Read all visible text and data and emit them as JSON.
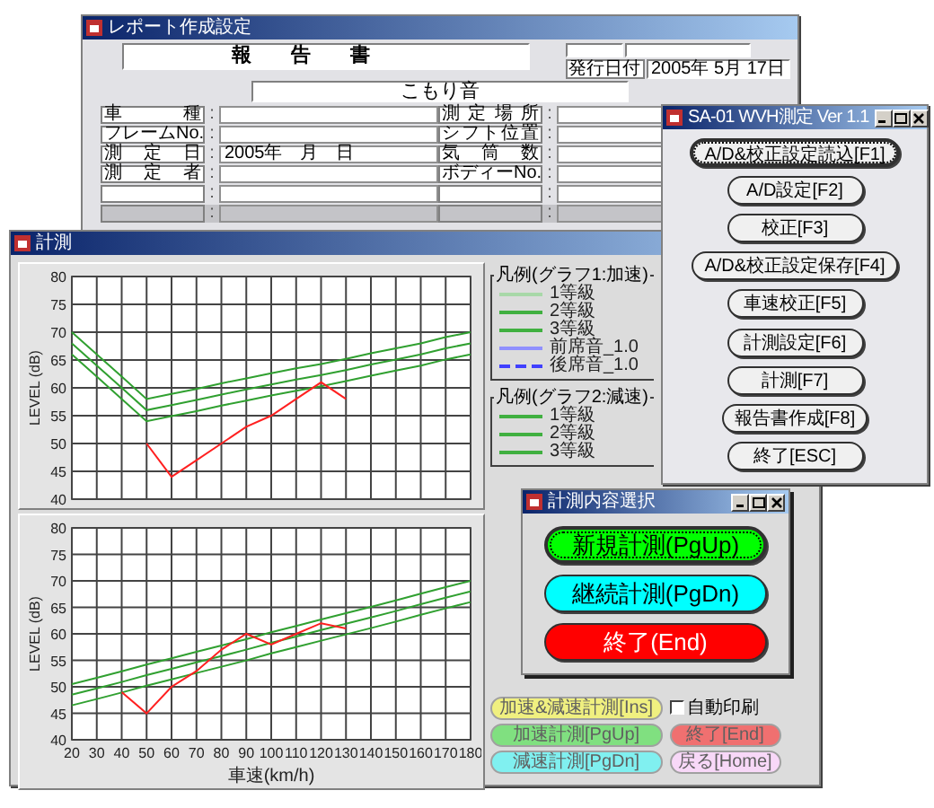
{
  "report_window": {
    "title": "レポート作成設定",
    "heading": "報　　告　　書",
    "issue_date_label": "発行日付",
    "issue_date": "2005年 5月 17日",
    "subtitle": "こもり音",
    "rows": [
      {
        "left_label": "車種",
        "left_sep": ":",
        "right_label": "測定場所",
        "right_sep": ":",
        "disabled": false
      },
      {
        "left_label": "フレームNo.",
        "left_sep": ":",
        "right_label": "シフト位置",
        "right_sep": ":",
        "disabled": false
      },
      {
        "left_label": "測定日",
        "left_sep": ":",
        "left_value": "2005年　月　日",
        "right_label": "気筒数",
        "right_sep": ":",
        "disabled": false
      },
      {
        "left_label": "測定者",
        "left_sep": ":",
        "right_label": "ボディーNo.",
        "right_sep": ":",
        "disabled": false
      },
      {
        "left_sep": ":",
        "right_sep": ":",
        "disabled": false
      },
      {
        "left_sep": ":",
        "right_sep": ":",
        "disabled": true
      }
    ]
  },
  "measure_window": {
    "title": "計測",
    "charts": [
      {
        "chart_data": {
          "type": "line",
          "grid": true,
          "ylabel": "LEVEL (dB)",
          "xlim": [
            20,
            180
          ],
          "ylim": [
            40,
            80
          ],
          "yticks": [
            40,
            45,
            50,
            55,
            60,
            65,
            70,
            75,
            80
          ],
          "x": [
            20,
            30,
            40,
            50,
            60,
            70,
            80,
            90,
            100,
            110,
            120,
            130,
            140,
            150,
            160,
            170,
            180
          ],
          "series": [
            {
              "color": "#30a030",
              "values": [
                70,
                66,
                62,
                58,
                58.9,
                59.8,
                60.8,
                61.7,
                62.6,
                63.5,
                64.3,
                65.2,
                66.2,
                67.1,
                68,
                69.1,
                70
              ]
            },
            {
              "color": "#30a030",
              "values": [
                68,
                64,
                60,
                56,
                56.9,
                57.8,
                58.8,
                59.7,
                60.6,
                61.5,
                62.3,
                63.2,
                64.2,
                65.1,
                66,
                67.1,
                68
              ]
            },
            {
              "color": "#30a030",
              "values": [
                66,
                62,
                58,
                54,
                54.9,
                55.8,
                56.8,
                57.7,
                58.6,
                59.5,
                60.3,
                61.2,
                62.2,
                63.1,
                64,
                65.1,
                66
              ]
            },
            {
              "color": "#ff2020",
              "values": [
                null,
                null,
                null,
                50,
                44,
                47,
                50,
                53,
                55,
                58,
                61,
                58,
                null,
                null,
                null,
                null,
                null
              ]
            }
          ]
        }
      },
      {
        "chart_data": {
          "type": "line",
          "grid": true,
          "xlabel": "車速(km/h)",
          "ylabel": "LEVEL (dB)",
          "xlim": [
            20,
            180
          ],
          "ylim": [
            40,
            80
          ],
          "xticks": [
            20,
            30,
            40,
            50,
            60,
            70,
            80,
            90,
            100,
            110,
            120,
            130,
            140,
            150,
            160,
            170,
            180
          ],
          "yticks": [
            40,
            45,
            50,
            55,
            60,
            65,
            70,
            75,
            80
          ],
          "x": [
            20,
            30,
            40,
            50,
            60,
            70,
            80,
            90,
            100,
            110,
            120,
            130,
            140,
            150,
            160,
            170,
            180
          ],
          "series": [
            {
              "color": "#30a030",
              "values": [
                50.5,
                51.7,
                52.9,
                54.2,
                55.4,
                56.6,
                57.8,
                59,
                60.3,
                61.5,
                62.7,
                63.9,
                65.1,
                66.3,
                67.6,
                68.8,
                70
              ]
            },
            {
              "color": "#30a030",
              "values": [
                48.5,
                49.7,
                50.9,
                52.2,
                53.4,
                54.6,
                55.8,
                57,
                58.3,
                59.5,
                60.7,
                61.9,
                63.1,
                64.3,
                65.6,
                66.8,
                68
              ]
            },
            {
              "color": "#30a030",
              "values": [
                46.5,
                47.7,
                48.9,
                50.2,
                51.4,
                52.6,
                53.8,
                55,
                56.3,
                57.5,
                58.7,
                59.9,
                61.1,
                62.3,
                63.6,
                64.8,
                66
              ]
            },
            {
              "color": "#ff2020",
              "values": [
                null,
                null,
                49,
                45,
                50,
                53,
                57,
                60,
                58,
                60,
                62,
                61,
                null,
                null,
                null,
                null,
                null
              ]
            }
          ]
        }
      }
    ],
    "legends": [
      {
        "title": "凡例(グラフ1:加速)",
        "items": [
          {
            "label": "1等級",
            "kind": "solid",
            "color": "#a8d8a8"
          },
          {
            "label": "2等級",
            "kind": "solid",
            "color": "#40b040"
          },
          {
            "label": "3等級",
            "kind": "solid",
            "color": "#40b040"
          },
          {
            "label": "前席音_1.0",
            "kind": "solid",
            "color": "#9090ff"
          },
          {
            "label": "後席音_1.0",
            "kind": "dashed",
            "color": "#4040ff"
          }
        ]
      },
      {
        "title": "凡例(グラフ2:減速)",
        "items": [
          {
            "label": "1等級",
            "kind": "solid",
            "color": "#40b040"
          },
          {
            "label": "2等級",
            "kind": "solid",
            "color": "#40b040"
          },
          {
            "label": "3等級",
            "kind": "solid",
            "color": "#40b040"
          }
        ]
      }
    ],
    "controls": [
      {
        "kind": "button",
        "label": "加速&減速計測[Ins]",
        "color": "#f0f080",
        "disabled": true
      },
      {
        "kind": "checkbox",
        "label": "自動印刷",
        "checked": false
      },
      {
        "kind": "button",
        "label": "加速計測[PgUp]",
        "color": "#80e080",
        "disabled": true
      },
      {
        "kind": "button",
        "label": "終了[End]",
        "color": "#f07070",
        "disabled": true
      },
      {
        "kind": "button",
        "label": "減速計測[PgDn]",
        "color": "#80f0f0",
        "disabled": true
      },
      {
        "kind": "button",
        "label": "戻る[Home]",
        "color": "#f8d8f8",
        "disabled": true
      }
    ]
  },
  "menu_window": {
    "title": "SA-01 WVH測定 Ver 1.1",
    "buttons": [
      {
        "label": "A/D&校正設定読込[F1]",
        "focused": true
      },
      {
        "label": "A/D設定[F2]",
        "focused": false
      },
      {
        "label": "校正[F3]",
        "focused": false
      },
      {
        "label": "A/D&校正設定保存[F4]",
        "focused": false
      },
      {
        "label": "車速校正[F5]",
        "focused": false
      },
      {
        "label": "計測設定[F6]",
        "focused": false
      },
      {
        "label": "計測[F7]",
        "focused": false
      },
      {
        "label": "報告書作成[F8]",
        "focused": false
      },
      {
        "label": "終了[ESC]",
        "focused": false
      }
    ]
  },
  "select_dialog": {
    "title": "計測内容選択",
    "buttons": [
      {
        "label": "新規計測(PgUp)",
        "color": "#00ff00",
        "focused": true
      },
      {
        "label": "継続計測(PgDn)",
        "color": "#00ffff",
        "focused": false
      },
      {
        "label": "終了(End)",
        "color": "#ff0000",
        "focused": false
      }
    ]
  }
}
